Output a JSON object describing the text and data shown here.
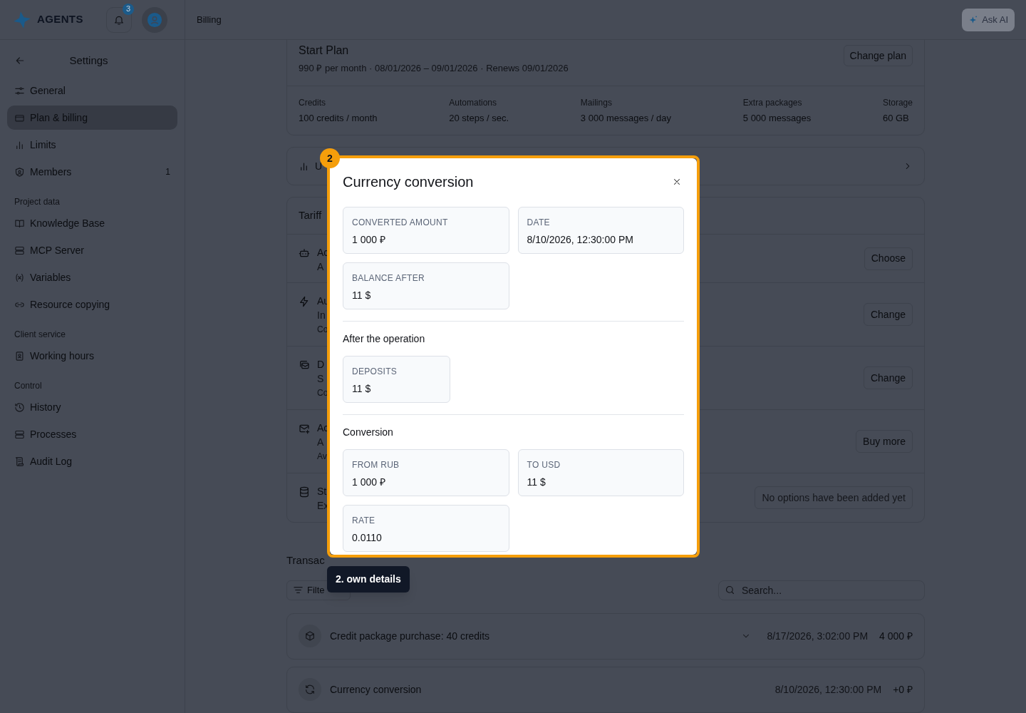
{
  "header": {
    "logo": "AGENTS",
    "notification_count": "3",
    "breadcrumb": "Billing",
    "ask_ai": "Ask AI"
  },
  "sidebar": {
    "title": "Settings",
    "sections": [
      {
        "items": [
          {
            "label": "General",
            "selected": false
          },
          {
            "label": "Plan & billing",
            "selected": true
          },
          {
            "label": "Limits",
            "selected": false
          },
          {
            "label": "Members",
            "selected": false,
            "count": "1"
          }
        ]
      },
      {
        "heading": "Project data",
        "items": [
          {
            "label": "Knowledge Base",
            "selected": false
          },
          {
            "label": "MCP Server",
            "selected": false
          },
          {
            "label": "Variables",
            "selected": false
          },
          {
            "label": "Resource copying",
            "selected": false
          }
        ]
      },
      {
        "heading": "Client service",
        "items": [
          {
            "label": "Working hours",
            "selected": false
          }
        ]
      },
      {
        "heading": "Control",
        "items": [
          {
            "label": "History",
            "selected": false
          },
          {
            "label": "Processes",
            "selected": false
          },
          {
            "label": "Audit Log",
            "selected": false
          }
        ]
      }
    ]
  },
  "plan": {
    "name": "Start Plan",
    "meta": "990 ₽ per month · 08/01/2026 – 09/01/2026 · Renews 09/01/2026",
    "button": "Change plan",
    "stats": [
      {
        "label": "Credits",
        "value": "100 credits / month"
      },
      {
        "label": "Automations",
        "value": "20 steps / sec."
      },
      {
        "label": "Mailings",
        "value": "3 000 messages / day"
      },
      {
        "label": "Extra packages",
        "value": "5 000 messages"
      },
      {
        "label": "Storage",
        "value": "60 GB"
      }
    ]
  },
  "usage_card": {
    "title": "U"
  },
  "tariff_card": {
    "title": "Tariff",
    "rows": [
      {
        "lines": [
          "Ac",
          "A"
        ],
        "action": {
          "kind": "button",
          "label": "Choose"
        }
      },
      {
        "lines": [
          "Au",
          "In",
          "Co"
        ],
        "action": {
          "kind": "button",
          "label": "Change"
        }
      },
      {
        "lines": [
          "D",
          "S",
          "Co"
        ],
        "action": {
          "kind": "button",
          "label": "Change"
        }
      },
      {
        "lines": [
          "Ac",
          "A",
          "Av"
        ],
        "action": {
          "kind": "button",
          "label": "Buy more"
        }
      },
      {
        "lines": [
          "St",
          "Ex"
        ],
        "action": {
          "kind": "note",
          "label": "No options have been added yet"
        }
      }
    ]
  },
  "transactions": {
    "title": "Transac",
    "filter": "Filte",
    "search": {
      "placeholder": "Search..."
    },
    "rows": [
      {
        "title": "Credit package purchase: 40 credits",
        "expandable": true,
        "date": "8/17/2026, 3:02:00 PM",
        "amount": "4 000 ₽"
      },
      {
        "title": "Currency conversion",
        "expandable": false,
        "date": "8/10/2026, 12:30:00 PM",
        "amount": "+0 ₽"
      }
    ]
  },
  "modal": {
    "title": "Currency conversion",
    "sections": [
      {
        "fields": [
          {
            "label": "CONVERTED AMOUNT",
            "value": "1 000 ₽"
          },
          {
            "label": "DATE",
            "value": "8/10/2026, 12:30:00 PM"
          },
          {
            "label": "BALANCE AFTER",
            "value": "11 $"
          }
        ]
      },
      {
        "heading": "After the operation",
        "fields": [
          {
            "label": "DEPOSITS",
            "value": "11 $"
          }
        ]
      },
      {
        "heading": "Conversion",
        "fields": [
          {
            "label": "FROM RUB",
            "value": "1 000 ₽"
          },
          {
            "label": "TO USD",
            "value": "11 $"
          },
          {
            "label": "RATE",
            "value": "0.0110"
          }
        ]
      }
    ]
  },
  "highlight": {
    "number": "2",
    "tooltip": "2. own details"
  }
}
